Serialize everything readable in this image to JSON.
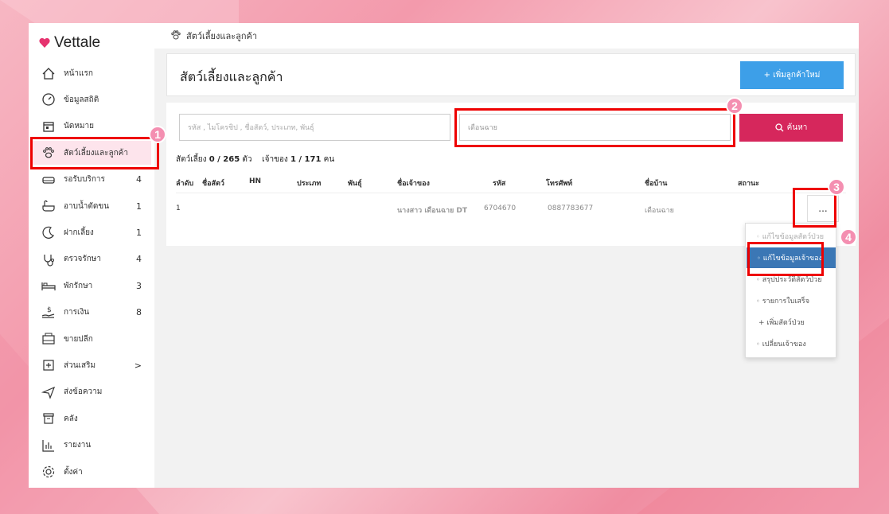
{
  "app": {
    "name": "Vettale",
    "brand_color": "#e6336f"
  },
  "sidebar": {
    "items": [
      {
        "label": "หน้าแรก",
        "icon": "home-icon",
        "count": ""
      },
      {
        "label": "ข้อมูลสถิติ",
        "icon": "dashboard-icon",
        "count": ""
      },
      {
        "label": "นัดหมาย",
        "icon": "calendar-icon",
        "count": ""
      },
      {
        "label": "สัตว์เลี้ยงและลูกค้า",
        "icon": "paw-icon",
        "count": ""
      },
      {
        "label": "รอรับบริการ",
        "icon": "sofa-icon",
        "count": "4"
      },
      {
        "label": "อาบน้ำตัดขน",
        "icon": "bathtub-icon",
        "count": "1"
      },
      {
        "label": "ฝากเลี้ยง",
        "icon": "moon-icon",
        "count": "1"
      },
      {
        "label": "ตรวจรักษา",
        "icon": "stethoscope-icon",
        "count": "4"
      },
      {
        "label": "พักรักษา",
        "icon": "bed-icon",
        "count": "3"
      },
      {
        "label": "การเงิน",
        "icon": "money-icon",
        "count": "8"
      },
      {
        "label": "ขายปลีก",
        "icon": "cash-register-icon",
        "count": ""
      },
      {
        "label": "ส่วนเสริม",
        "icon": "plus-box-icon",
        "count": ">"
      },
      {
        "label": "ส่งข้อความ",
        "icon": "send-icon",
        "count": ""
      },
      {
        "label": "คลัง",
        "icon": "archive-icon",
        "count": ""
      },
      {
        "label": "รายงาน",
        "icon": "bar-chart-icon",
        "count": ""
      },
      {
        "label": "ตั้งค่า",
        "icon": "gear-icon",
        "count": ""
      }
    ]
  },
  "topbar": {
    "breadcrumb": "สัตว์เลี้ยงและลูกค้า"
  },
  "header": {
    "title": "สัตว์เลี้ยงและลูกค้า",
    "add_button": "+ เพิ่มลูกค้าใหม่"
  },
  "search": {
    "placeholder": "รหัส , ไมโครชิป , ชื่อสัตว์, ประเภท, พันธุ์",
    "owner_value": "เดือนฉาย",
    "button": "ค้นหา"
  },
  "summary": {
    "pets_label": "สัตว์เลี้ยง",
    "pets_value": "0 / 265",
    "pets_unit": "ตัว",
    "owners_label": "เจ้าของ",
    "owners_value": "1 / 171",
    "owners_unit": "คน"
  },
  "table": {
    "headers": [
      "ลำดับ",
      "ชื่อสัตว์",
      "HN",
      "ประเภท",
      "พันธุ์",
      "ชื่อเจ้าของ",
      "รหัส",
      "โทรศัพท์",
      "ชื่อบ้าน",
      "สถานะ"
    ],
    "row": {
      "no": "1",
      "owner": "นางสาว เดือนฉาย DT",
      "code": "6704670",
      "phone": "0887783677",
      "house": "เดือนฉาย"
    },
    "more": "..."
  },
  "menu": {
    "items": [
      "แก้ไขข้อมูลสัตว์ป่วย",
      "แก้ไขข้อมูลเจ้าของ",
      "สรุปประวัติสัตว์ป่วย",
      "รายการใบเสร็จ",
      "+ เพิ่มสัตว์ป่วย",
      "เปลี่ยนเจ้าของ"
    ]
  },
  "annotations": [
    "1",
    "2",
    "3",
    "4"
  ]
}
